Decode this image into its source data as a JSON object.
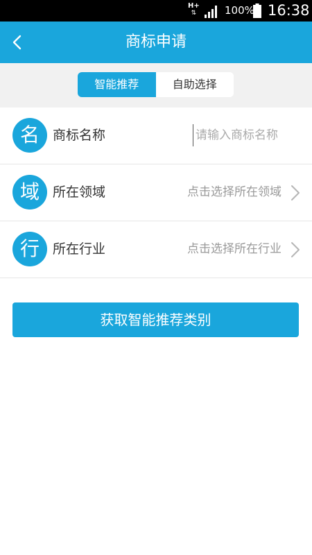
{
  "status_bar": {
    "network_type": "H+",
    "network_arrows": "⇅",
    "battery_percent": "100%",
    "time": "16:38"
  },
  "header": {
    "back_icon": "chevron-left-icon",
    "title": "商标申请"
  },
  "tabs": [
    {
      "label": "智能推荐",
      "active": true
    },
    {
      "label": "自助选择",
      "active": false
    }
  ],
  "form": {
    "rows": [
      {
        "badge": "名",
        "label": "商标名称",
        "placeholder": "请输入商标名称",
        "value": ""
      },
      {
        "badge": "域",
        "label": "所在领域",
        "hint": "点击选择所在领域"
      },
      {
        "badge": "行",
        "label": "所在行业",
        "hint": "点击选择所在行业"
      }
    ]
  },
  "submit_label": "获取智能推荐类别",
  "colors": {
    "primary": "#1aa6dc",
    "background": "#f1f1f1",
    "text": "#333333",
    "hint": "#999999"
  }
}
